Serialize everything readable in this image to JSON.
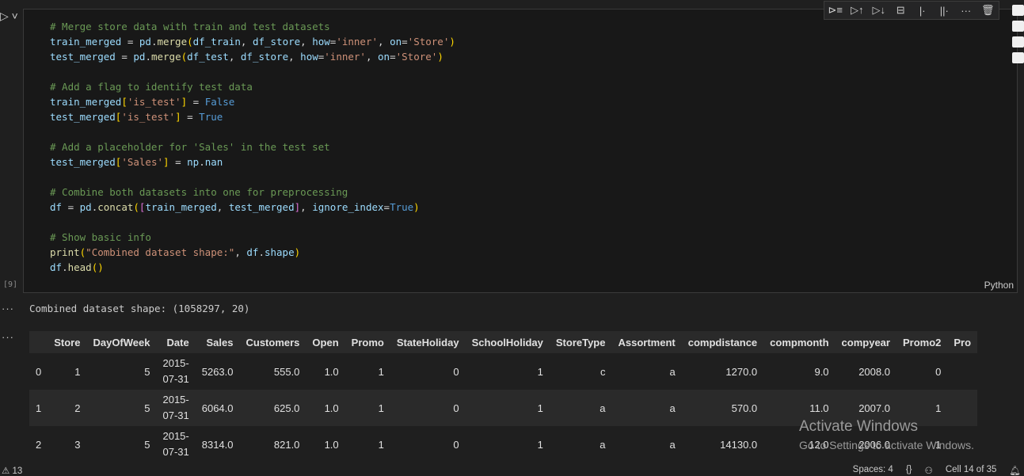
{
  "cell": {
    "execution_count": "[9]",
    "language": "Python",
    "code_lines": [
      [
        {
          "t": "# Merge store data with train and test datasets",
          "c": "c-com"
        }
      ],
      [
        {
          "t": "train_merged",
          "c": "c-var"
        },
        {
          "t": " = ",
          "c": "c-op"
        },
        {
          "t": "pd",
          "c": "c-var"
        },
        {
          "t": ".",
          "c": "c-op"
        },
        {
          "t": "merge",
          "c": "c-fn"
        },
        {
          "t": "(",
          "c": "c-br1"
        },
        {
          "t": "df_train",
          "c": "c-var"
        },
        {
          "t": ", ",
          "c": "c-op"
        },
        {
          "t": "df_store",
          "c": "c-var"
        },
        {
          "t": ", ",
          "c": "c-op"
        },
        {
          "t": "how",
          "c": "c-var"
        },
        {
          "t": "=",
          "c": "c-op"
        },
        {
          "t": "'inner'",
          "c": "c-str"
        },
        {
          "t": ", ",
          "c": "c-op"
        },
        {
          "t": "on",
          "c": "c-var"
        },
        {
          "t": "=",
          "c": "c-op"
        },
        {
          "t": "'Store'",
          "c": "c-str"
        },
        {
          "t": ")",
          "c": "c-br1"
        }
      ],
      [
        {
          "t": "test_merged",
          "c": "c-var"
        },
        {
          "t": " = ",
          "c": "c-op"
        },
        {
          "t": "pd",
          "c": "c-var"
        },
        {
          "t": ".",
          "c": "c-op"
        },
        {
          "t": "merge",
          "c": "c-fn"
        },
        {
          "t": "(",
          "c": "c-br1"
        },
        {
          "t": "df_test",
          "c": "c-var"
        },
        {
          "t": ", ",
          "c": "c-op"
        },
        {
          "t": "df_store",
          "c": "c-var"
        },
        {
          "t": ", ",
          "c": "c-op"
        },
        {
          "t": "how",
          "c": "c-var"
        },
        {
          "t": "=",
          "c": "c-op"
        },
        {
          "t": "'inner'",
          "c": "c-str"
        },
        {
          "t": ", ",
          "c": "c-op"
        },
        {
          "t": "on",
          "c": "c-var"
        },
        {
          "t": "=",
          "c": "c-op"
        },
        {
          "t": "'Store'",
          "c": "c-str"
        },
        {
          "t": ")",
          "c": "c-br1"
        }
      ],
      [],
      [
        {
          "t": "# Add a flag to identify test data",
          "c": "c-com"
        }
      ],
      [
        {
          "t": "train_merged",
          "c": "c-var"
        },
        {
          "t": "[",
          "c": "c-br1"
        },
        {
          "t": "'is_test'",
          "c": "c-str"
        },
        {
          "t": "]",
          "c": "c-br1"
        },
        {
          "t": " = ",
          "c": "c-op"
        },
        {
          "t": "False",
          "c": "c-kw"
        }
      ],
      [
        {
          "t": "test_merged",
          "c": "c-var"
        },
        {
          "t": "[",
          "c": "c-br1"
        },
        {
          "t": "'is_test'",
          "c": "c-str"
        },
        {
          "t": "]",
          "c": "c-br1"
        },
        {
          "t": " = ",
          "c": "c-op"
        },
        {
          "t": "True",
          "c": "c-kw"
        }
      ],
      [],
      [
        {
          "t": "# Add a placeholder for 'Sales' in the test set",
          "c": "c-com"
        }
      ],
      [
        {
          "t": "test_merged",
          "c": "c-var"
        },
        {
          "t": "[",
          "c": "c-br1"
        },
        {
          "t": "'Sales'",
          "c": "c-str"
        },
        {
          "t": "]",
          "c": "c-br1"
        },
        {
          "t": " = ",
          "c": "c-op"
        },
        {
          "t": "np",
          "c": "c-var"
        },
        {
          "t": ".",
          "c": "c-op"
        },
        {
          "t": "nan",
          "c": "c-var"
        }
      ],
      [],
      [
        {
          "t": "# Combine both datasets into one for preprocessing",
          "c": "c-com"
        }
      ],
      [
        {
          "t": "df",
          "c": "c-var"
        },
        {
          "t": " = ",
          "c": "c-op"
        },
        {
          "t": "pd",
          "c": "c-var"
        },
        {
          "t": ".",
          "c": "c-op"
        },
        {
          "t": "concat",
          "c": "c-fn"
        },
        {
          "t": "(",
          "c": "c-br1"
        },
        {
          "t": "[",
          "c": "c-br2"
        },
        {
          "t": "train_merged",
          "c": "c-var"
        },
        {
          "t": ", ",
          "c": "c-op"
        },
        {
          "t": "test_merged",
          "c": "c-var"
        },
        {
          "t": "]",
          "c": "c-br2"
        },
        {
          "t": ", ",
          "c": "c-op"
        },
        {
          "t": "ignore_index",
          "c": "c-var"
        },
        {
          "t": "=",
          "c": "c-op"
        },
        {
          "t": "True",
          "c": "c-kw"
        },
        {
          "t": ")",
          "c": "c-br1"
        }
      ],
      [],
      [
        {
          "t": "# Show basic info",
          "c": "c-com"
        }
      ],
      [
        {
          "t": "print",
          "c": "c-fn"
        },
        {
          "t": "(",
          "c": "c-br1"
        },
        {
          "t": "\"Combined dataset shape:\"",
          "c": "c-str"
        },
        {
          "t": ", ",
          "c": "c-op"
        },
        {
          "t": "df",
          "c": "c-var"
        },
        {
          "t": ".",
          "c": "c-op"
        },
        {
          "t": "shape",
          "c": "c-var"
        },
        {
          "t": ")",
          "c": "c-br1"
        }
      ],
      [
        {
          "t": "df",
          "c": "c-var"
        },
        {
          "t": ".",
          "c": "c-op"
        },
        {
          "t": "head",
          "c": "c-fn"
        },
        {
          "t": "()",
          "c": "c-br1"
        }
      ]
    ]
  },
  "toolbar": {
    "icons": [
      "run-by-line-icon",
      "execute-above-icon",
      "execute-below-icon",
      "split-cell-icon",
      "add-cell-above-icon",
      "add-markdown-icon",
      "more-icon",
      "delete-icon"
    ],
    "glyphs": [
      "⊳≡",
      "▷↑",
      "▷↓",
      "⊟",
      "|·",
      "||·",
      "···",
      "🗑"
    ]
  },
  "output": {
    "text": "Combined dataset shape: (1058297, 20)",
    "dots": "···",
    "columns": [
      "",
      "Store",
      "DayOfWeek",
      "Date",
      "Sales",
      "Customers",
      "Open",
      "Promo",
      "StateHoliday",
      "SchoolHoliday",
      "StoreType",
      "Assortment",
      "compdistance",
      "compmonth",
      "compyear",
      "Promo2",
      "Pro"
    ],
    "rows": [
      [
        "0",
        "1",
        "5",
        "2015-07-31",
        "5263.0",
        "555.0",
        "1.0",
        "1",
        "0",
        "1",
        "c",
        "a",
        "1270.0",
        "9.0",
        "2008.0",
        "0",
        ""
      ],
      [
        "1",
        "2",
        "5",
        "2015-07-31",
        "6064.0",
        "625.0",
        "1.0",
        "1",
        "0",
        "1",
        "a",
        "a",
        "570.0",
        "11.0",
        "2007.0",
        "1",
        ""
      ],
      [
        "2",
        "3",
        "5",
        "2015-07-31",
        "8314.0",
        "821.0",
        "1.0",
        "1",
        "0",
        "1",
        "a",
        "a",
        "14130.0",
        "12.0",
        "2006.0",
        "1",
        ""
      ]
    ]
  },
  "watermark": {
    "title": "Activate Windows",
    "subtitle": "Go to Settings to activate Windows."
  },
  "status": {
    "problems": "⚠ 13",
    "spaces": "Spaces: 4",
    "braces": "{}",
    "cell": "Cell 14 of 35"
  }
}
